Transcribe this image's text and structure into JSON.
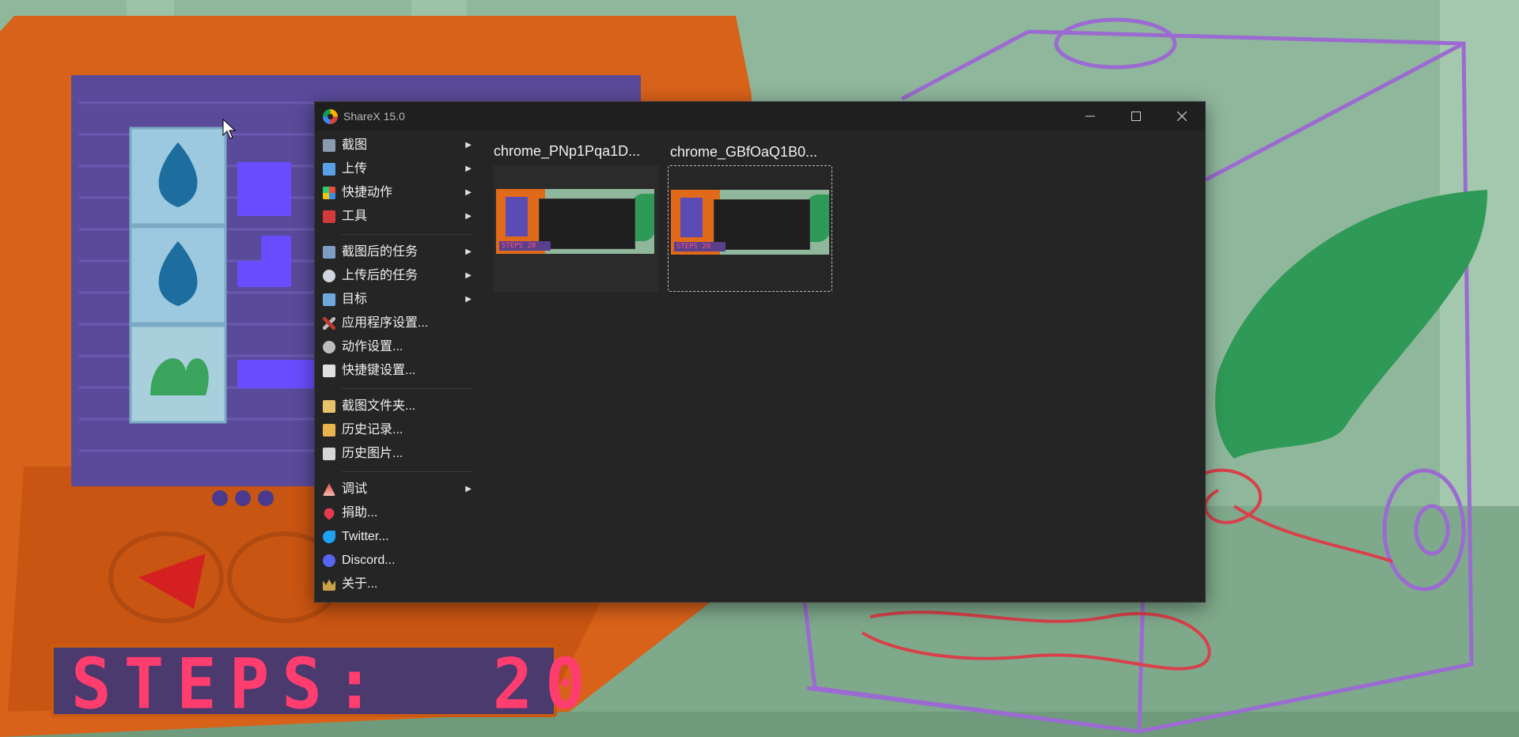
{
  "window": {
    "title": "ShareX 15.0",
    "controls": {
      "minimize": "—",
      "maximize": "□",
      "close": "✕"
    }
  },
  "menu": {
    "group1": [
      {
        "label": "截图",
        "icon": "capture-icon",
        "submenu": true
      },
      {
        "label": "上传",
        "icon": "upload-arrow-icon",
        "submenu": true
      },
      {
        "label": "快捷动作",
        "icon": "workflow-grid-icon",
        "submenu": true
      },
      {
        "label": "工具",
        "icon": "toolbox-icon",
        "submenu": true
      }
    ],
    "group2": [
      {
        "label": "截图后的任务",
        "icon": "after-capture-icon",
        "submenu": true
      },
      {
        "label": "上传后的任务",
        "icon": "cloud-upload-icon",
        "submenu": true
      },
      {
        "label": "目标",
        "icon": "destination-icon",
        "submenu": true
      },
      {
        "label": "应用程序设置...",
        "icon": "wrench-screwdriver-icon",
        "submenu": false
      },
      {
        "label": "动作设置...",
        "icon": "gear-icon",
        "submenu": false
      },
      {
        "label": "快捷键设置...",
        "icon": "keyboard-icon",
        "submenu": false
      }
    ],
    "group3": [
      {
        "label": "截图文件夹...",
        "icon": "folder-icon",
        "submenu": false
      },
      {
        "label": "历史记录...",
        "icon": "history-list-icon",
        "submenu": false
      },
      {
        "label": "历史图片...",
        "icon": "image-history-icon",
        "submenu": false
      }
    ],
    "group4": [
      {
        "label": "调试",
        "icon": "debug-cone-icon",
        "submenu": true
      },
      {
        "label": "捐助...",
        "icon": "heart-icon",
        "submenu": false
      },
      {
        "label": "Twitter...",
        "icon": "twitter-bird-icon",
        "submenu": false
      },
      {
        "label": "Discord...",
        "icon": "discord-icon",
        "submenu": false
      },
      {
        "label": "关于...",
        "icon": "crown-icon",
        "submenu": false
      }
    ],
    "arrow_glyph": "▶"
  },
  "thumbnails": [
    {
      "label": "chrome_PNp1Pqa1D...",
      "selected": false,
      "mini_steps": "STEPS 20"
    },
    {
      "label": "chrome_GBfOaQ1B0...",
      "selected": true,
      "mini_steps": "STEPS 20"
    }
  ],
  "game": {
    "steps_display": "STEPS:  20"
  },
  "colors": {
    "window_bg": "#252525",
    "titlebar_bg": "#1f1f1f",
    "text": "#f0f0f0",
    "steps_text": "#ff3d6e",
    "steps_panel": "#4a3a6e",
    "machine_orange": "#d9621a",
    "purple_outline": "#9b6bd1",
    "wall_green": "#8fb79b"
  }
}
